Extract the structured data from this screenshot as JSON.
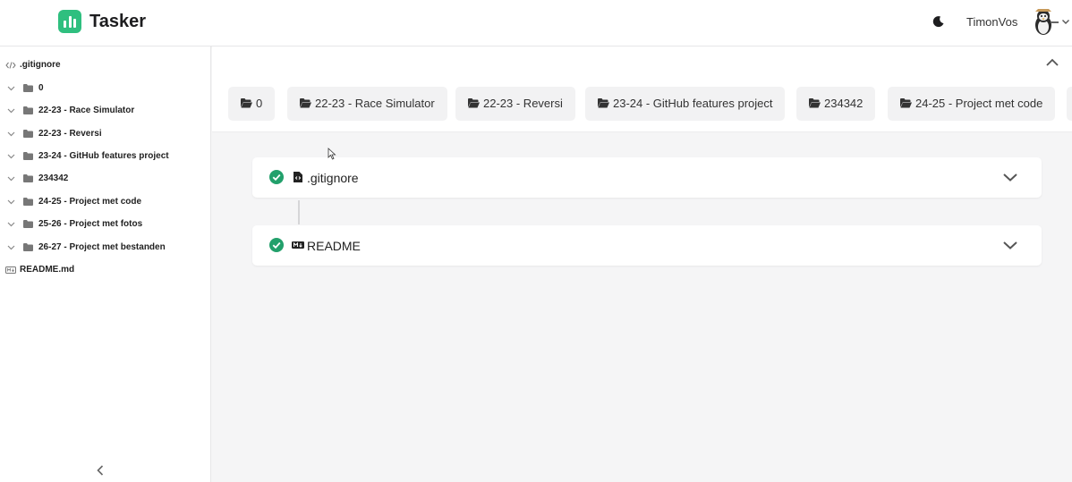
{
  "app": {
    "title": "Tasker"
  },
  "header": {
    "username": "TimonVos"
  },
  "sidebar": {
    "root_file": ".gitignore",
    "folders": [
      {
        "label": "0"
      },
      {
        "label": "22-23 - Race Simulator"
      },
      {
        "label": "22-23 - Reversi"
      },
      {
        "label": "23-24 - GitHub features project"
      },
      {
        "label": "234342"
      },
      {
        "label": "24-25 - Project met code"
      },
      {
        "label": "25-26 - Project met fotos"
      },
      {
        "label": "26-27 - Project met bestanden"
      }
    ],
    "readme_file": "README.md"
  },
  "breadcrumbs": [
    {
      "label": "0"
    },
    {
      "label": "22-23 - Race Simulator"
    },
    {
      "label": "22-23 - Reversi"
    },
    {
      "label": "23-24 - GitHub features project"
    },
    {
      "label": "234342"
    },
    {
      "label": "24-25 - Project met code"
    }
  ],
  "cards": [
    {
      "title": ".gitignore",
      "icon": "file-code-icon",
      "status": "completed"
    },
    {
      "title": "README",
      "icon": "markdown-icon",
      "status": "completed"
    }
  ],
  "colors": {
    "accent": "#2fbf7f",
    "check": "#22a06b"
  }
}
